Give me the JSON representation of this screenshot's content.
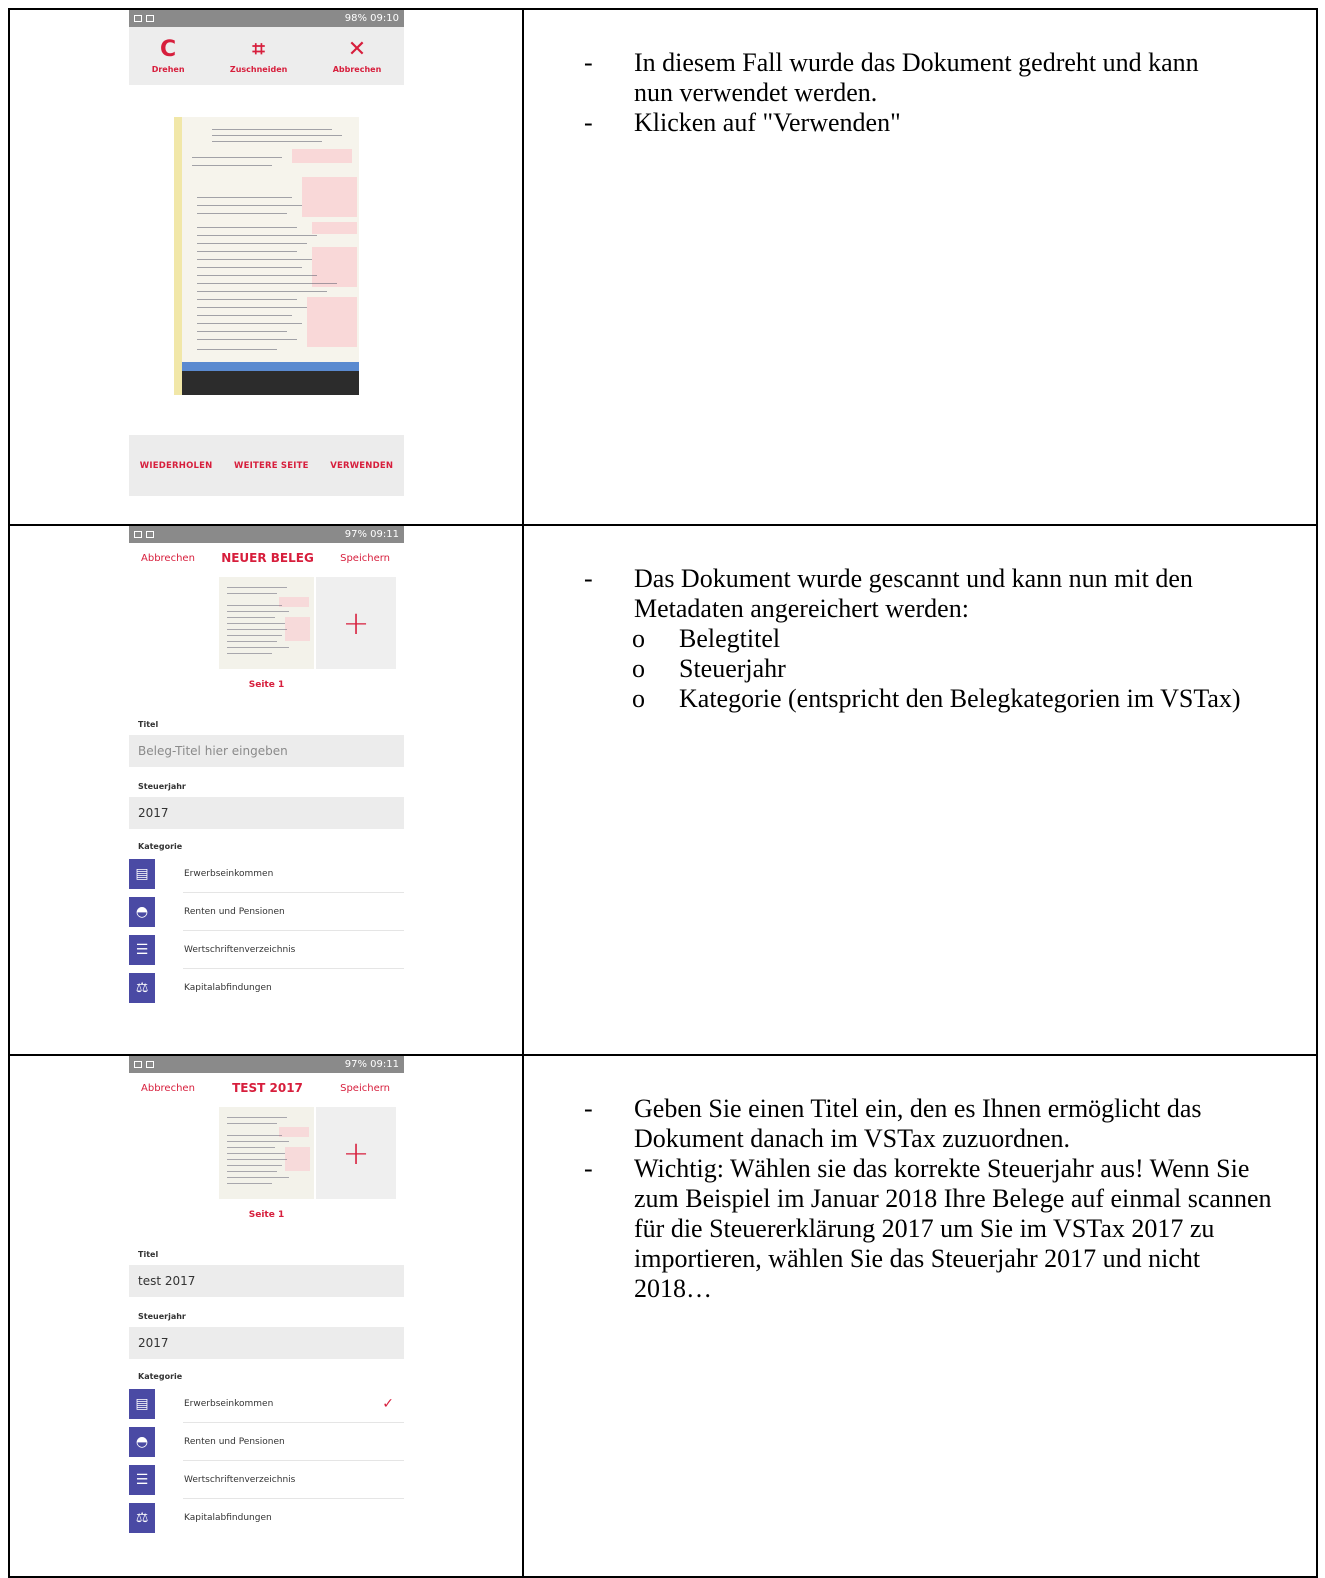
{
  "rows": [
    {
      "phone": {
        "status": "98% 09:10",
        "tools": [
          {
            "icon": "C",
            "label": "Drehen"
          },
          {
            "icon": "⌗",
            "label": "Zuschneiden"
          },
          {
            "icon": "✕",
            "label": "Abbrechen"
          }
        ],
        "bottom": [
          "WIEDERHOLEN",
          "WEITERE SEITE",
          "VERWENDEN"
        ]
      },
      "text": {
        "bullets": [
          "In diesem Fall wurde das Dokument gedreht und kann nun verwendet werden.",
          "Klicken auf \"Verwenden\""
        ]
      }
    },
    {
      "phone": {
        "status": "97% 09:11",
        "cancel": "Abbrechen",
        "title": "NEUER BELEG",
        "save": "Speichern",
        "page_label": "Seite 1",
        "title_label": "Titel",
        "title_placeholder": "Beleg-Titel hier eingeben",
        "year_label": "Steuerjahr",
        "year_value": "2017",
        "category_label": "Kategorie",
        "categories": [
          "Erwerbseinkommen",
          "Renten und Pensionen",
          "Wertschriftenverzeichnis",
          "Kapitalabfindungen"
        ]
      },
      "text": {
        "bullet": "Das Dokument wurde gescannt und kann nun mit den Metadaten angereichert werden:",
        "subitems": [
          "Belegtitel",
          "Steuerjahr",
          "Kategorie (entspricht den Belegkategorien im VSTax)"
        ]
      }
    },
    {
      "phone": {
        "status": "97% 09:11",
        "cancel": "Abbrechen",
        "title": "TEST 2017",
        "save": "Speichern",
        "page_label": "Seite 1",
        "title_label": "Titel",
        "title_value": "test 2017",
        "year_label": "Steuerjahr",
        "year_value": "2017",
        "category_label": "Kategorie",
        "categories": [
          "Erwerbseinkommen",
          "Renten und Pensionen",
          "Wertschriftenverzeichnis",
          "Kapitalabfindungen"
        ],
        "selected_category": "Erwerbseinkommen"
      },
      "text": {
        "bullets": [
          "Geben Sie einen Titel ein, den es Ihnen ermöglicht das Dokument danach im VSTax zuzuordnen.",
          "Wichtig: Wählen sie das korrekte Steuerjahr aus! Wenn Sie zum Beispiel im Januar 2018 Ihre Belege auf einmal scannen für die Steuererklärung 2017 um Sie im VSTax 2017 zu importieren, wählen Sie das Steuerjahr 2017 und nicht 2018…"
        ]
      }
    }
  ],
  "colors": {
    "accent": "#d71e3c",
    "category_icon": "#4a4aa4",
    "statusbar": "#8a8a8a"
  }
}
